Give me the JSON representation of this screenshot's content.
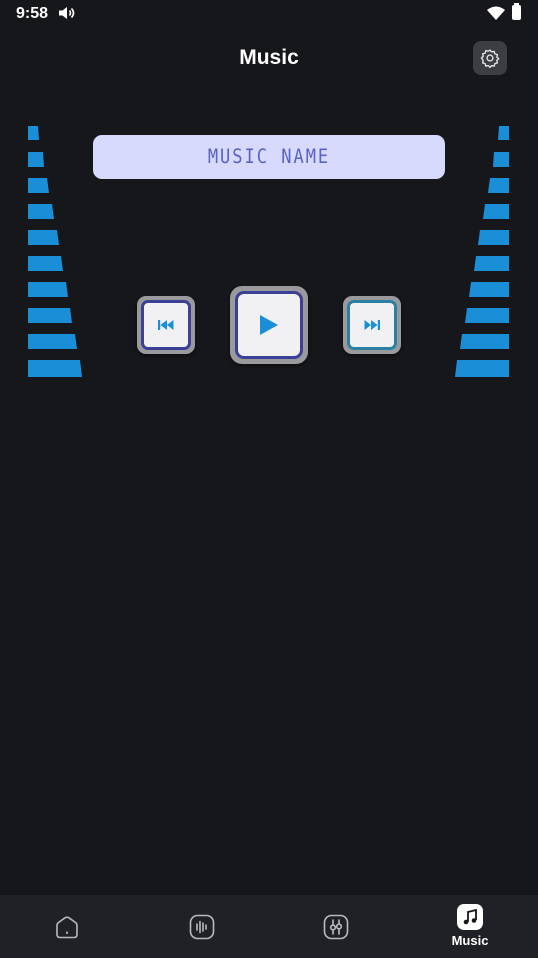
{
  "status_bar": {
    "time": "9:58",
    "icons": [
      "volume-icon",
      "wifi-icon",
      "battery-icon"
    ]
  },
  "header": {
    "title": "Music",
    "settings_icon": "gear-icon"
  },
  "player": {
    "track_name": "MUSIC NAME",
    "controls": [
      "previous-icon",
      "play-icon",
      "next-icon"
    ]
  },
  "bottom_nav": {
    "items": [
      {
        "icon": "home-icon",
        "label": ""
      },
      {
        "icon": "sound-wave-icon",
        "label": ""
      },
      {
        "icon": "equalizer-icon",
        "label": ""
      },
      {
        "icon": "music-note-icon",
        "label": "Music",
        "active": true
      }
    ]
  },
  "colors": {
    "background": "#16171b",
    "nav_background": "#202126",
    "lcd_background": "#d7dafc",
    "lcd_text": "#5a63c4",
    "eq_bar": "#1a8fd8",
    "accent": "#1a8fd8"
  }
}
